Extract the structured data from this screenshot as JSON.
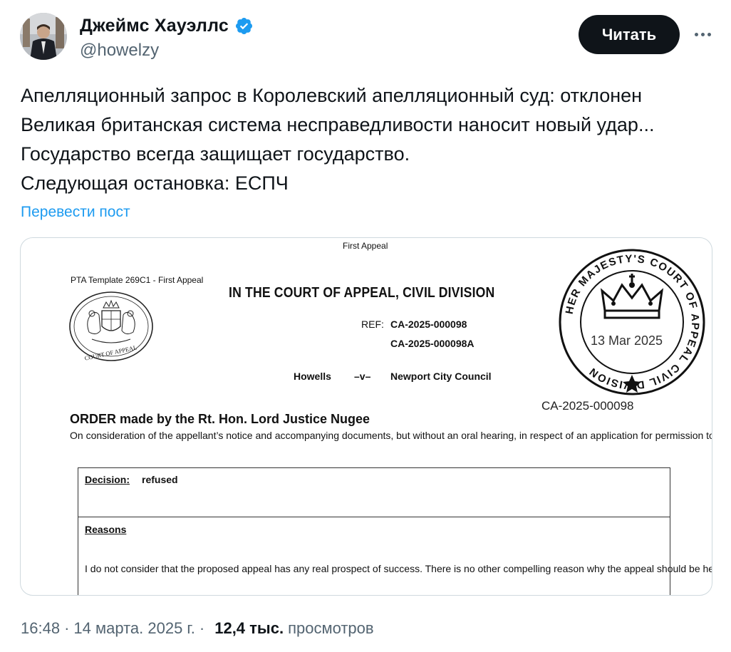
{
  "author": {
    "display_name": "Джеймс Хауэллс",
    "handle": "@howelzy"
  },
  "actions": {
    "follow_label": "Читать",
    "more_icon": "ellipsis-horizontal-icon"
  },
  "tweet": {
    "lines": [
      "Апелляционный запрос в Королевский апелляционный суд: отклонен",
      "Великая британская система несправедливости наносит новый удар...",
      "Государство всегда защищает государство.",
      "Следующая остановка: ЕСПЧ"
    ],
    "translate_label": "Перевести пост"
  },
  "document": {
    "header_top": "First Appeal",
    "template": "PTA Template 269C1 - First Appeal",
    "court_title": "IN THE COURT OF APPEAL, CIVIL DIVISION",
    "ref_label": "REF:",
    "ref_numbers": [
      "CA-2025-000098",
      "CA-2025-000098A"
    ],
    "parties": {
      "appellant": "Howells",
      "versus": "–v–",
      "respondent": "Newport City Council"
    },
    "seal_text": "COURT OF APPEAL",
    "stamp": {
      "ring_text": "HER MAJESTY'S COURT OF APPEAL CIVIL DIVISION",
      "date": "13 Mar 2025",
      "ref": "CA-2025-000098"
    },
    "order_title": "ORDER made by the Rt. Hon. Lord Justice  Nugee",
    "order_body": "On consideration of the appellant’s notice and accompanying documents, but without an oral hearing, in respect of an application for permission to appeal",
    "decision_label": "Decision",
    "decision_value": "refused",
    "reasons_label": "Reasons",
    "reasons_body": "I do not consider that the proposed appeal has any real prospect of success.  There is no other compelling reason why the appeal should be heard and permission must therefore be refused."
  },
  "footer": {
    "time": "16:48",
    "date": "14 марта. 2025 г.",
    "separator": "·",
    "views_count": "12,4 тыс.",
    "views_label": "просмотров"
  },
  "colors": {
    "text": "#0f1419",
    "secondary": "#536471",
    "link": "#1d9bf0",
    "verified": "#1d9bf0",
    "button_bg": "#0f1419"
  }
}
